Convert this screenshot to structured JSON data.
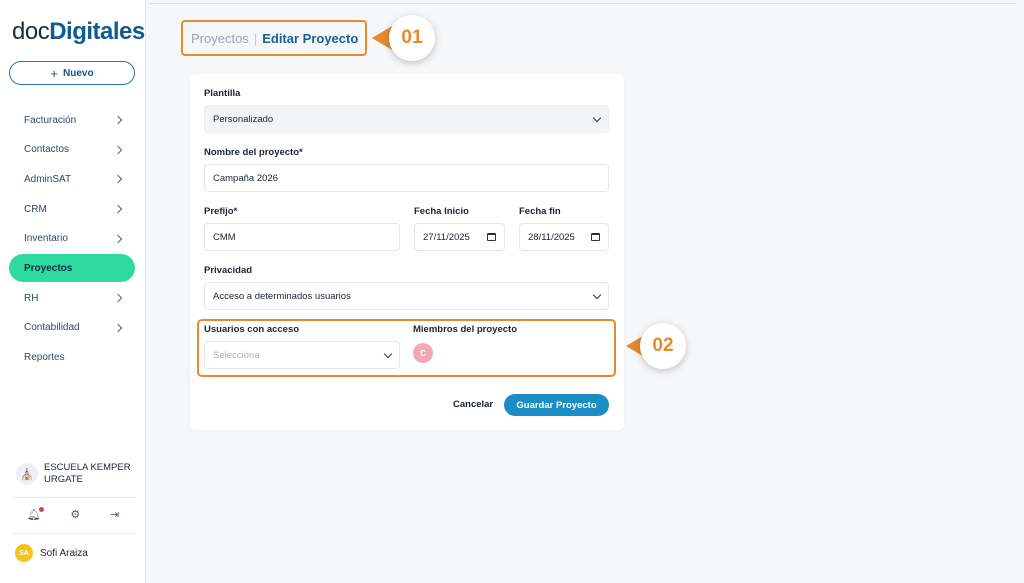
{
  "app": {
    "logo_light": "doc",
    "logo_bold": "Digitales"
  },
  "sidebar": {
    "new_button": {
      "icon": "plus-icon",
      "label": "Nuevo"
    },
    "items": [
      {
        "label": "Facturación",
        "has_children": true,
        "active": false
      },
      {
        "label": "Contactos",
        "has_children": true,
        "active": false
      },
      {
        "label": "AdminSAT",
        "has_children": true,
        "active": false
      },
      {
        "label": "CRM",
        "has_children": true,
        "active": false
      },
      {
        "label": "Inventario",
        "has_children": true,
        "active": false
      },
      {
        "label": "Proyectos",
        "has_children": false,
        "active": true
      },
      {
        "label": "RH",
        "has_children": true,
        "active": false
      },
      {
        "label": "Contabilidad",
        "has_children": true,
        "active": false
      },
      {
        "label": "Reportes",
        "has_children": false,
        "active": false
      }
    ],
    "organization": {
      "name": "ESCUELA KEMPER URGATE",
      "icon": "school-crest-icon"
    },
    "utility_icons": [
      "bell-icon",
      "gear-icon",
      "logout-icon"
    ],
    "user": {
      "initials": "SA",
      "name": "Sofi Araiza"
    }
  },
  "breadcrumb": {
    "parent": "Proyectos",
    "separator": "|",
    "current": "Editar Proyecto"
  },
  "callouts": {
    "first": "01",
    "second": "02"
  },
  "form": {
    "template": {
      "label": "Plantilla",
      "value": "Personalizado"
    },
    "project_name": {
      "label": "Nombre del proyecto*",
      "value": "Campaña 2026"
    },
    "prefix": {
      "label": "Prefijo*",
      "value": "CMM"
    },
    "start_date": {
      "label": "Fecha Inicio",
      "value": "27/11/2025"
    },
    "end_date": {
      "label": "Fecha fin",
      "value": "28/11/2025"
    },
    "privacy": {
      "label": "Privacidad",
      "value": "Acceso a determinados usuarios"
    },
    "users_access": {
      "label": "Usuarios con acceso",
      "placeholder": "Selecciona"
    },
    "members": {
      "label": "Miembros del proyecto",
      "badge": "C"
    },
    "cancel_label": "Cancelar",
    "save_label": "Guardar Proyecto"
  },
  "colors": {
    "accent": "#e58a2e",
    "active_nav": "#2ed9a0",
    "primary_button": "#1a8dc4",
    "brand": "#0f5c8f"
  }
}
